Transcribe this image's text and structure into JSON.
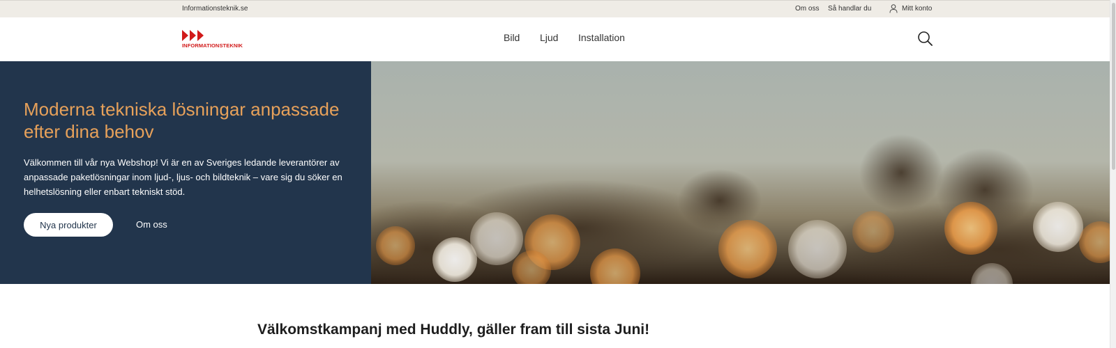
{
  "topbar": {
    "site_name": "Informationsteknik.se",
    "links": {
      "about": "Om oss",
      "how_to_shop": "Så handlar du",
      "account": "Mitt konto"
    }
  },
  "header": {
    "logo_text": "INFORMATIONSTEKNIK",
    "nav": {
      "bild": "Bild",
      "ljud": "Ljud",
      "installation": "Installation"
    }
  },
  "hero": {
    "title": "Moderna tekniska lösningar anpassade efter dina behov",
    "text": "Välkommen till vår nya Webshop! Vi är en av Sveriges ledande leverantörer av anpassade paketlösningar inom ljud-, ljus- och bildteknik – vare sig du söker en helhetslösning eller enbart tekniskt stöd.",
    "primary_button": "Nya produkter",
    "secondary_link": "Om oss"
  },
  "promo": {
    "heading": "Välkomstkampanj med Huddly, gäller fram till sista Juni!"
  },
  "colors": {
    "hero_panel": "#22354c",
    "hero_title": "#e7a15a",
    "logo_red": "#d11a1a",
    "topbar_bg": "#efece6"
  },
  "icons": {
    "account": "user-icon",
    "search": "search-icon",
    "logo": "triple-arrow-logo-icon"
  }
}
